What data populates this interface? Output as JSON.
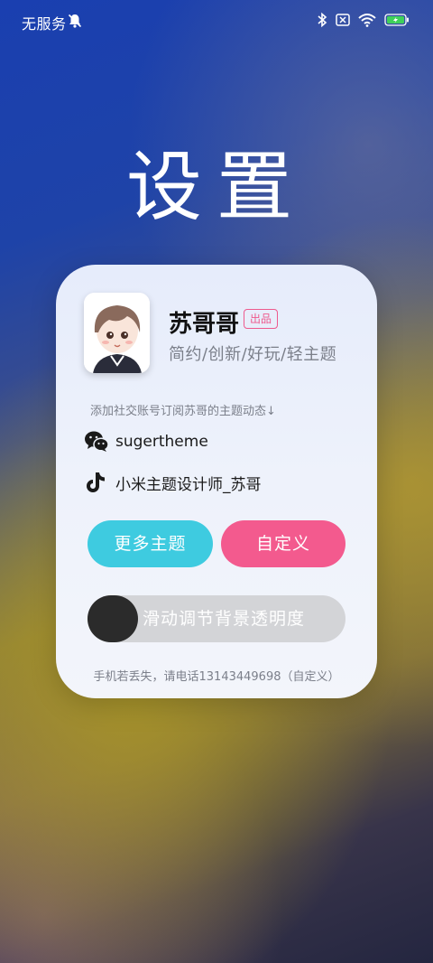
{
  "status_bar": {
    "carrier": "无服务",
    "icons": [
      "mute-icon",
      "bluetooth-icon",
      "no-sim-icon",
      "wifi-icon",
      "battery-charging-icon"
    ]
  },
  "page": {
    "title": "设置"
  },
  "profile": {
    "name": "苏哥哥",
    "badge": "出品",
    "tagline": "简约/创新/好玩/轻主题"
  },
  "social": {
    "hint": "添加社交账号订阅苏哥的主题动态↓",
    "wechat": {
      "icon": "wechat-icon",
      "label": "sugertheme"
    },
    "tiktok": {
      "icon": "tiktok-icon",
      "label": "小米主题设计师_苏哥"
    }
  },
  "buttons": {
    "more_themes": "更多主题",
    "customize": "自定义"
  },
  "slider": {
    "label": "滑动调节背景透明度",
    "value": 0
  },
  "footer": "手机若丢失，请电话13143449698（自定义）",
  "colors": {
    "more_button": "#3ecbe0",
    "customize_button": "#f35a8e",
    "badge": "#ee5a8e"
  }
}
